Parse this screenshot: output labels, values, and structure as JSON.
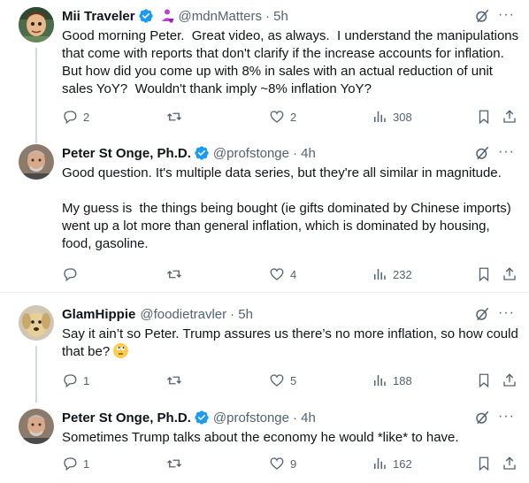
{
  "tweets": [
    {
      "name": "Mii Traveler",
      "handle": "@mdnMatters",
      "time": "· 5h",
      "text": "Good morning Peter.  Great video, as always.  I understand the manipulations that come with reports that don't clarify if the increase accounts for inflation.  But how did you come up with 8% in sales with an actual reduction of unit sales YoY?  Wouldn't thank imply ~8% inflation YoY?",
      "replies": "2",
      "reposts": "",
      "likes": "2",
      "views": "308"
    },
    {
      "name": "Peter St Onge, Ph.D.",
      "handle": "@profstonge",
      "time": "· 4h",
      "text": "Good question. It's multiple data series, but they're all similar in magnitude.\n\nMy guess is  the things being bought (ie gifts dominated by Chinese imports) went up a lot more than general inflation, which is dominated by housing, food, gasoline.",
      "replies": "",
      "reposts": "",
      "likes": "4",
      "views": "232"
    },
    {
      "name": "GlamHippie",
      "handle": "@foodietravler",
      "time": "· 5h",
      "text": "Say it ain’t so Peter. Trump assures us there’s no more inflation, so how could that be?",
      "replies": "1",
      "reposts": "",
      "likes": "5",
      "views": "188"
    },
    {
      "name": "Peter St Onge, Ph.D.",
      "handle": "@profstonge",
      "time": "· 4h",
      "text": "Sometimes Trump talks about the economy he would *like* to have.",
      "replies": "1",
      "reposts": "",
      "likes": "9",
      "views": "162"
    }
  ],
  "more_label": "···",
  "colors": {
    "verified": "#1d9bf0",
    "muted": "#536471",
    "divider": "#eff3f4",
    "thread": "#cfd9de",
    "affiliate": "#c53bd7"
  },
  "icons": [
    "reply-icon",
    "repost-icon",
    "like-icon",
    "views-icon",
    "bookmark-icon",
    "share-icon",
    "grok-icon",
    "verified-icon",
    "more-icon"
  ]
}
